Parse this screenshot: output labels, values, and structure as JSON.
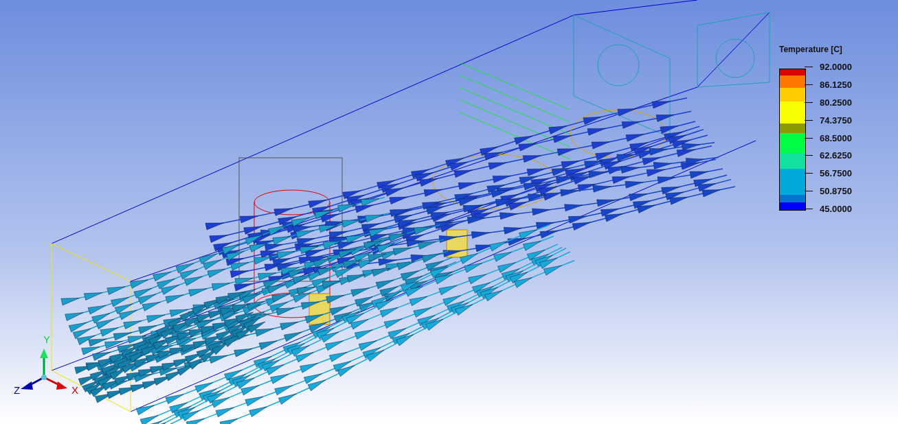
{
  "legend": {
    "title": "Temperature [C]",
    "ticks": [
      "92.0000",
      "86.1250",
      "80.2500",
      "74.3750",
      "68.5000",
      "62.6250",
      "56.7500",
      "50.8750",
      "45.0000"
    ],
    "bands": [
      {
        "color": "#dd0000"
      },
      {
        "color": "#ff7700"
      },
      {
        "color": "#ffcc00"
      },
      {
        "color": "#f8ff00"
      },
      {
        "color": "#8a9a00"
      },
      {
        "color": "#00ff44"
      },
      {
        "color": "#11e0a0"
      },
      {
        "color": "#00aadd"
      },
      {
        "color": "#0077cc"
      },
      {
        "color": "#0000ff"
      }
    ]
  },
  "axes": {
    "x": "X",
    "y": "Y",
    "z": "Z"
  }
}
